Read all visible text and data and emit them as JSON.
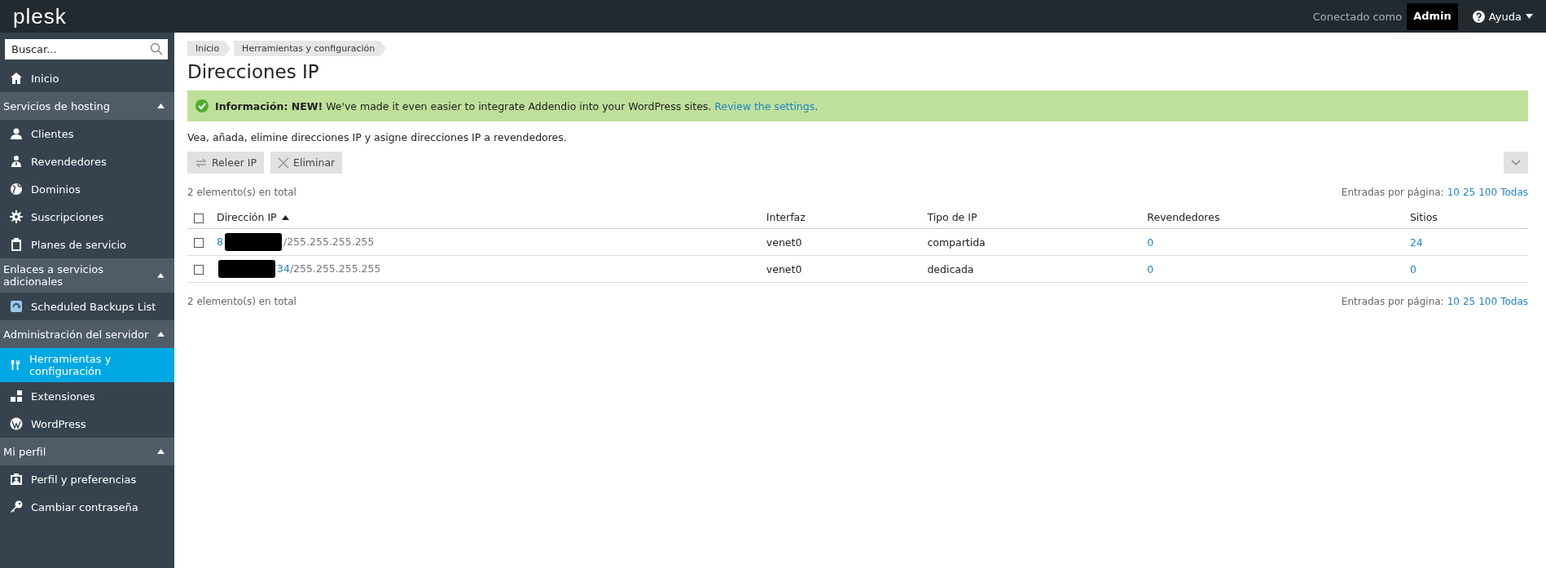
{
  "topbar": {
    "logo": "plesk",
    "connected_label": "Conectado como",
    "user": "Admin",
    "help": "Ayuda"
  },
  "sidebar": {
    "search": {
      "placeholder": "Buscar..."
    },
    "top_items": [
      {
        "label": "Inicio",
        "selected": false
      }
    ],
    "sections": [
      {
        "title": "Servicios de hosting",
        "expanded": true,
        "items": [
          {
            "label": "Clientes",
            "selected": false
          },
          {
            "label": "Revendedores",
            "selected": false
          },
          {
            "label": "Dominios",
            "selected": false
          },
          {
            "label": "Suscripciones",
            "selected": false
          },
          {
            "label": "Planes de servicio",
            "selected": false
          }
        ]
      },
      {
        "title": "Enlaces a servicios adicionales",
        "expanded": true,
        "items": [
          {
            "label": "Scheduled Backups List",
            "selected": false
          }
        ]
      },
      {
        "title": "Administración del servidor",
        "expanded": true,
        "items": [
          {
            "label": "Herramientas y configuración",
            "selected": true
          },
          {
            "label": "Extensiones",
            "selected": false
          },
          {
            "label": "WordPress",
            "selected": false
          }
        ]
      },
      {
        "title": "Mi perfil",
        "expanded": true,
        "items": [
          {
            "label": "Perfil y preferencias",
            "selected": false
          },
          {
            "label": "Cambiar contraseña",
            "selected": false
          }
        ]
      }
    ]
  },
  "breadcrumbs": [
    "Inicio",
    "Herramientas y configuración"
  ],
  "page_title": "Direcciones IP",
  "banner": {
    "text": "**Información: NEW!** We've made it even easier to integrate Addendio into your WordPress sites.",
    "link": "Review the settings",
    "tail": "."
  },
  "description": "Vea, añada, elimine direcciones IP y asigne direcciones IP a revendedores.",
  "toolbar": [
    "Releer IP",
    "Eliminar"
  ],
  "pagination": {
    "total": "2 elemento(s) en total",
    "label": "Entradas por página:",
    "options": [
      "10",
      "25",
      "100",
      "Todas"
    ]
  },
  "table": {
    "select_all_checked": false,
    "columns": [
      "Dirección IP",
      "Interfaz",
      "Tipo de IP",
      "Revendedores",
      "Sitios"
    ],
    "rows": [
      {
        "checked": false,
        "ip_parts": [
          {
            "kind": "link",
            "text": "8"
          },
          {
            "kind": "redacted"
          },
          {
            "kind": "mask",
            "text": "/255.255.255.255"
          }
        ],
        "interface": "venet0",
        "type": "compartida",
        "resellers": "0",
        "sites": "24"
      },
      {
        "checked": false,
        "ip_parts": [
          {
            "kind": "redacted"
          },
          {
            "kind": "link",
            "text": "34"
          },
          {
            "kind": "mask",
            "text": "/255.255.255.255"
          }
        ],
        "interface": "venet0",
        "type": "dedicada",
        "resellers": "0",
        "sites": "0"
      }
    ]
  },
  "footer_pagination": {
    "total": "2 elemento(s) en total",
    "label": "Entradas por página:",
    "options": [
      "10",
      "25",
      "100",
      "Todas"
    ]
  }
}
